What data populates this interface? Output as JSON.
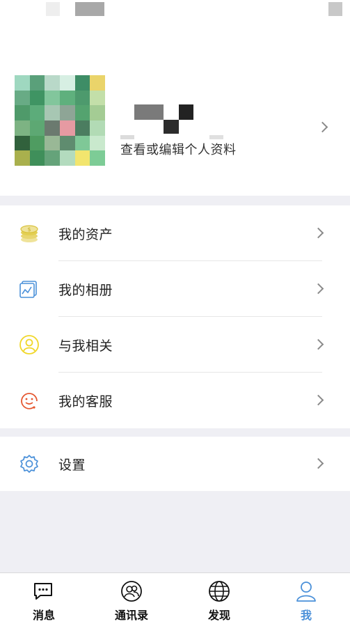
{
  "profile": {
    "subtitle": "查看或编辑个人资料"
  },
  "menu_group_1": [
    {
      "label": "我的资产",
      "icon": "coins-icon",
      "color": "#e8d44d"
    },
    {
      "label": "我的相册",
      "icon": "album-icon",
      "color": "#4a90d9"
    },
    {
      "label": "与我相关",
      "icon": "user-circle-icon",
      "color": "#f0c419"
    },
    {
      "label": "我的客服",
      "icon": "customer-service-icon",
      "color": "#e5562f"
    }
  ],
  "menu_group_2": [
    {
      "label": "设置",
      "icon": "gear-icon",
      "color": "#4a90d9"
    }
  ],
  "tabbar": [
    {
      "label": "消息",
      "icon": "chat-bubble-icon",
      "active": false
    },
    {
      "label": "通讯录",
      "icon": "contacts-icon",
      "active": false
    },
    {
      "label": "发现",
      "icon": "globe-icon",
      "active": false
    },
    {
      "label": "我",
      "icon": "person-icon",
      "active": true
    }
  ],
  "colors": {
    "accent": "#4a90d9",
    "background": "#efeff4",
    "text": "#222222"
  }
}
